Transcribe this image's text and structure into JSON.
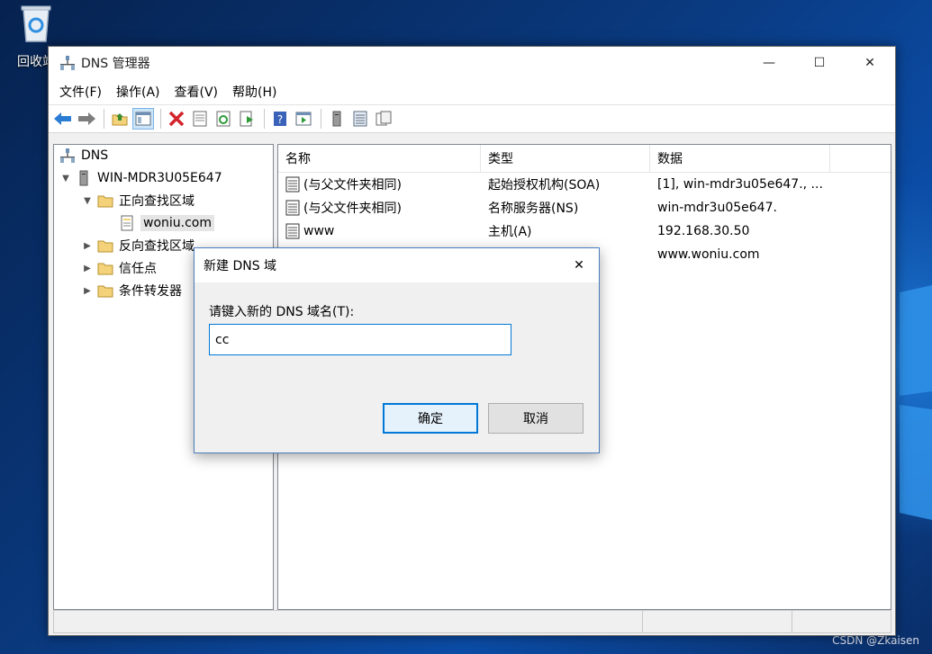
{
  "desktop": {
    "recycle_bin_label": "回收站",
    "watermark": "CSDN @Zkaisen"
  },
  "window": {
    "title": "DNS 管理器",
    "controls": {
      "minimize": "—",
      "maximize": "☐",
      "close": "✕"
    }
  },
  "menu": [
    "文件(F)",
    "操作(A)",
    "查看(V)",
    "帮助(H)"
  ],
  "toolbar": {
    "icons": [
      "back-arrow-icon",
      "forward-arrow-icon",
      "up-folder-icon",
      "show-hide-tree-icon",
      "delete-icon",
      "properties-icon",
      "refresh-icon",
      "export-list-icon",
      "help-icon",
      "action-pane-icon",
      "server-icon",
      "zone-list-icon",
      "copy-records-icon"
    ]
  },
  "tree": {
    "root": "DNS",
    "server": "WIN-MDR3U05E647",
    "forward_zones": "正向查找区域",
    "zone": "woniu.com",
    "reverse_zones": "反向查找区域",
    "trust_points": "信任点",
    "conditional_forwarders": "条件转发器"
  },
  "list": {
    "columns": [
      "名称",
      "类型",
      "数据"
    ],
    "rows": [
      {
        "name": "(与父文件夹相同)",
        "type": "起始授权机构(SOA)",
        "data": "[1], win-mdr3u05e647., ..."
      },
      {
        "name": "(与父文件夹相同)",
        "type": "名称服务器(NS)",
        "data": "win-mdr3u05e647."
      },
      {
        "name": "www",
        "type": "主机(A)",
        "data": "192.168.30.50"
      },
      {
        "name": "",
        "type": "",
        "data": "www.woniu.com"
      }
    ]
  },
  "dialog": {
    "title": "新建 DNS 域",
    "close": "✕",
    "prompt": "请键入新的 DNS 域名(T):",
    "input_value": "cc",
    "ok": "确定",
    "cancel": "取消"
  },
  "colors": {
    "accent": "#0078d7",
    "folder": "#f3d27a"
  }
}
